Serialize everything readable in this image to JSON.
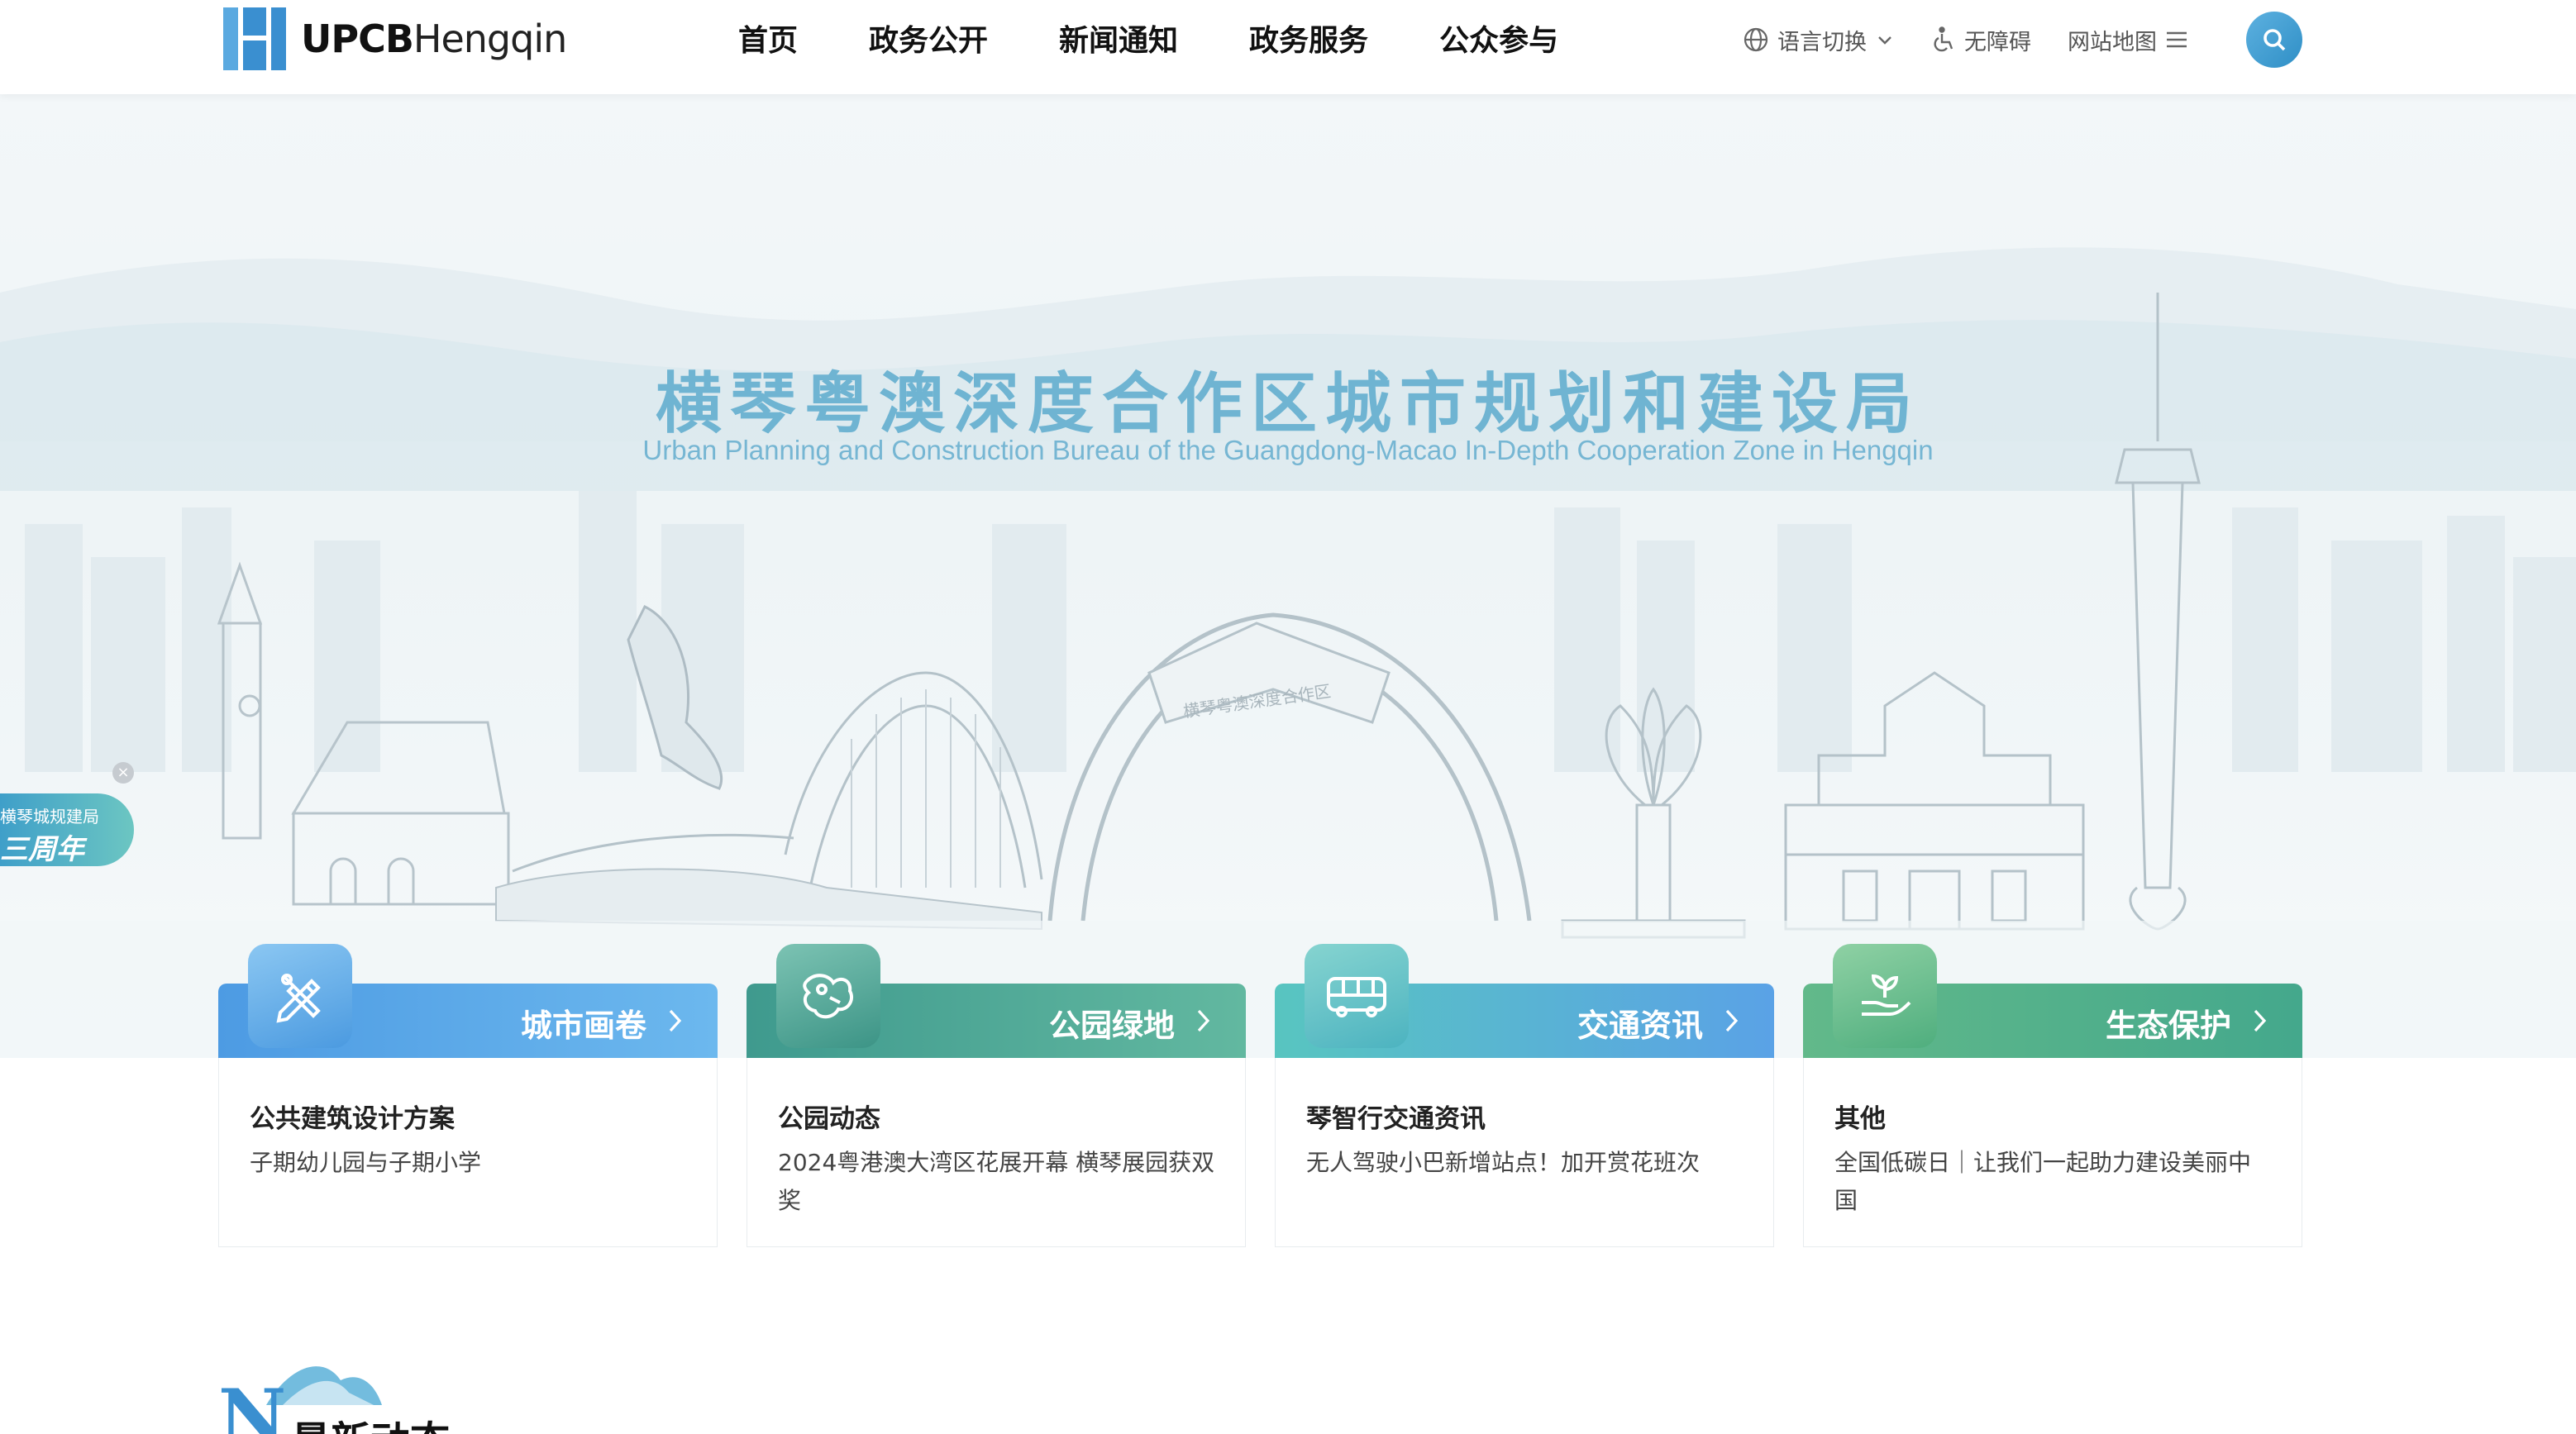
{
  "header": {
    "logo": {
      "bold": "UPCB",
      "light": "Hengqin"
    },
    "nav": [
      "首页",
      "政务公开",
      "新闻通知",
      "政务服务",
      "公众参与"
    ],
    "tools": {
      "language": "语言切换",
      "accessibility": "无障碍",
      "sitemap": "网站地图"
    }
  },
  "hero": {
    "title": "横琴粤澳深度合作区城市规划和建设局",
    "subtitle": "Urban Planning and Construction Bureau of the Guangdong-Macao In-Depth Cooperation Zone in Hengqin",
    "arch_text": "横琴粤澳深度合作区"
  },
  "badge": {
    "small": "横琴城规建局",
    "big": "三周年",
    "close": "×"
  },
  "cards": [
    {
      "title": "城市画卷",
      "subtitle": "公共建筑设计方案",
      "text": "子期幼儿园与子期小学",
      "icon": "pencil-ruler-icon",
      "color_from": "#4d9be3",
      "color_to": "#6cb8ee"
    },
    {
      "title": "公园绿地",
      "subtitle": "公园动态",
      "text": "2024粤港澳大湾区花展开幕 横琴展园获双奖",
      "icon": "park-map-icon",
      "color_from": "#3f9a8e",
      "color_to": "#62b8a0"
    },
    {
      "title": "交通资讯",
      "subtitle": "琴智行交通资讯",
      "text": "无人驾驶小巴新增站点！加开赏花班次",
      "icon": "bus-icon",
      "color_from": "#58c5c0",
      "color_to": "#5aa2e6"
    },
    {
      "title": "生态保护",
      "subtitle": "其他",
      "text": "全国低碳日｜让我们一起助力建设美丽中国",
      "icon": "sprout-hand-icon",
      "color_from": "#62b98a",
      "color_to": "#44a88c"
    }
  ],
  "news": {
    "title": "最新动态",
    "letter": "N"
  },
  "colors": {
    "accent": "#2f8fc6",
    "title_blue": "#6fb4d2"
  }
}
